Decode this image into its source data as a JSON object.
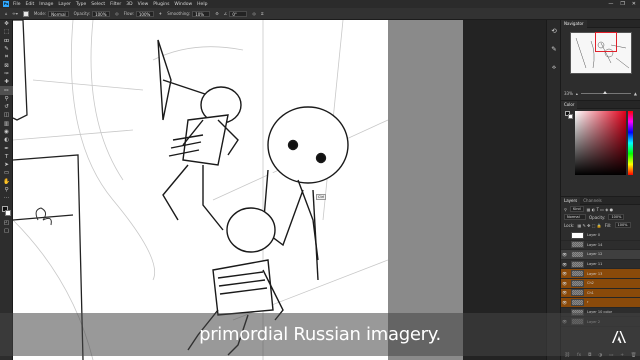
{
  "app": {
    "logo": "Ps",
    "menus": [
      "File",
      "Edit",
      "Image",
      "Layer",
      "Type",
      "Select",
      "Filter",
      "3D",
      "View",
      "Plugins",
      "Window",
      "Help"
    ],
    "window_controls": [
      "—",
      "❐",
      "✕"
    ]
  },
  "options_bar": {
    "mode_label": "Mode:",
    "mode_value": "Normal",
    "opacity_label": "Opacity:",
    "opacity_value": "100%",
    "flow_label": "Flow:",
    "flow_value": "100%",
    "smoothing_label": "Smoothing:",
    "smoothing_value": "10%",
    "angle_value": "0°"
  },
  "tools": [
    "move-icon",
    "marquee-icon",
    "lasso-icon",
    "quick-select-icon",
    "crop-icon",
    "frame-icon",
    "eyedropper-icon",
    "healing-icon",
    "brush-icon",
    "stamp-icon",
    "history-brush-icon",
    "eraser-icon",
    "gradient-icon",
    "blur-icon",
    "dodge-icon",
    "pen-icon",
    "type-icon",
    "path-select-icon",
    "shape-icon",
    "hand-icon",
    "zoom-icon",
    "more-tools-icon"
  ],
  "tool_glyphs": [
    "✥",
    "⬚",
    "ꝏ",
    "✎",
    "⌗",
    "⊠",
    "✑",
    "✚",
    "✏",
    "⚲",
    "↺",
    "◫",
    "▥",
    "◉",
    "◐",
    "✒",
    "T",
    "➤",
    "▭",
    "✋",
    "⚲",
    "···"
  ],
  "canvas": {
    "tooltip": "Ctrl"
  },
  "navigator": {
    "tab_label": "Navigator",
    "zoom": "33%"
  },
  "color": {
    "tab_label": "Color",
    "accent": "#e0001a"
  },
  "layers": {
    "tabs": [
      "Layers",
      "Channels"
    ],
    "filter_label": "Kind",
    "blend_mode": "Normal",
    "opacity_label": "Opacity:",
    "opacity_value": "100%",
    "lock_label": "Lock:",
    "fill_label": "Fill:",
    "fill_value": "100%",
    "items": [
      {
        "name": "Layer 0"
      },
      {
        "name": "Layer 14"
      },
      {
        "name": "Layer 12"
      },
      {
        "name": "Layer 11"
      },
      {
        "name": "Layer 13"
      },
      {
        "name": "Ch2"
      },
      {
        "name": "Ch1"
      },
      {
        "name": "r"
      },
      {
        "name": "Layer 10 color"
      },
      {
        "name": "Layer 2"
      }
    ],
    "footer_icons": [
      "link-icon",
      "fx-icon",
      "mask-icon",
      "adjustment-icon",
      "group-icon",
      "new-layer-icon",
      "trash-icon"
    ],
    "footer_glyphs": [
      "⛓",
      "fx",
      "◘",
      "◑",
      "▭",
      "+",
      "🗑"
    ]
  },
  "subtitle": {
    "text": "primordial Russian imagery."
  }
}
